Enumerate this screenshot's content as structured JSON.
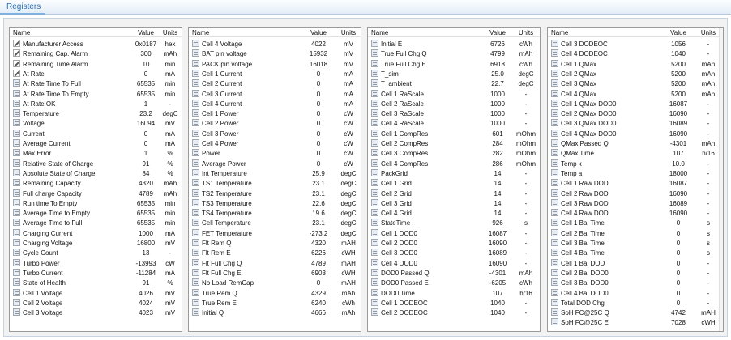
{
  "window": {
    "title": "Registers"
  },
  "columns": {
    "name": "Name",
    "value": "Value",
    "units": "Units"
  },
  "panels": [
    {
      "rows": [
        {
          "name": "Manufacturer Access",
          "value": "0x0187",
          "units": "hex",
          "icon": "edit-icon"
        },
        {
          "name": "Remaining Cap. Alarm",
          "value": "300",
          "units": "mAh",
          "icon": "edit-icon"
        },
        {
          "name": "Remaining Time Alarm",
          "value": "10",
          "units": "min",
          "icon": "edit-icon"
        },
        {
          "name": "At Rate",
          "value": "0",
          "units": "mA",
          "icon": "edit-icon"
        },
        {
          "name": "At Rate Time To Full",
          "value": "65535",
          "units": "min",
          "icon": "readonly-icon"
        },
        {
          "name": "At Rate Time To Empty",
          "value": "65535",
          "units": "min",
          "icon": "readonly-icon"
        },
        {
          "name": "At Rate OK",
          "value": "1",
          "units": "-",
          "icon": "readonly-icon"
        },
        {
          "name": "Temperature",
          "value": "23.2",
          "units": "degC",
          "icon": "readonly-icon"
        },
        {
          "name": "Voltage",
          "value": "16094",
          "units": "mV",
          "icon": "readonly-icon"
        },
        {
          "name": "Current",
          "value": "0",
          "units": "mA",
          "icon": "readonly-icon"
        },
        {
          "name": "Average Current",
          "value": "0",
          "units": "mA",
          "icon": "readonly-icon"
        },
        {
          "name": "Max Error",
          "value": "1",
          "units": "%",
          "icon": "readonly-icon"
        },
        {
          "name": "Relative State of Charge",
          "value": "91",
          "units": "%",
          "icon": "readonly-icon"
        },
        {
          "name": "Absolute State of Charge",
          "value": "84",
          "units": "%",
          "icon": "readonly-icon"
        },
        {
          "name": "Remaining Capacity",
          "value": "4320",
          "units": "mAh",
          "icon": "readonly-icon"
        },
        {
          "name": "Full charge Capacity",
          "value": "4789",
          "units": "mAh",
          "icon": "readonly-icon"
        },
        {
          "name": "Run time To Empty",
          "value": "65535",
          "units": "min",
          "icon": "readonly-icon"
        },
        {
          "name": "Average Time to Empty",
          "value": "65535",
          "units": "min",
          "icon": "readonly-icon"
        },
        {
          "name": "Average Time to Full",
          "value": "65535",
          "units": "min",
          "icon": "readonly-icon"
        },
        {
          "name": "Charging Current",
          "value": "1000",
          "units": "mA",
          "icon": "readonly-icon"
        },
        {
          "name": "Charging Voltage",
          "value": "16800",
          "units": "mV",
          "icon": "readonly-icon"
        },
        {
          "name": "Cycle Count",
          "value": "13",
          "units": "-",
          "icon": "readonly-icon"
        },
        {
          "name": "Turbo Power",
          "value": "-13993",
          "units": "cW",
          "icon": "readonly-icon"
        },
        {
          "name": "Turbo Current",
          "value": "-11284",
          "units": "mA",
          "icon": "readonly-icon"
        },
        {
          "name": "State of Health",
          "value": "91",
          "units": "%",
          "icon": "readonly-icon"
        },
        {
          "name": "Cell 1 Voltage",
          "value": "4026",
          "units": "mV",
          "icon": "readonly-icon"
        },
        {
          "name": "Cell 2 Voltage",
          "value": "4024",
          "units": "mV",
          "icon": "readonly-icon"
        },
        {
          "name": "Cell 3 Voltage",
          "value": "4023",
          "units": "mV",
          "icon": "readonly-icon"
        }
      ]
    },
    {
      "rows": [
        {
          "name": "Cell 4 Voltage",
          "value": "4022",
          "units": "mV",
          "icon": "readonly-icon"
        },
        {
          "name": "BAT pin voltage",
          "value": "15932",
          "units": "mV",
          "icon": "readonly-icon"
        },
        {
          "name": "PACK pin voltage",
          "value": "16018",
          "units": "mV",
          "icon": "readonly-icon"
        },
        {
          "name": "Cell 1 Current",
          "value": "0",
          "units": "mA",
          "icon": "readonly-icon"
        },
        {
          "name": "Cell 2 Current",
          "value": "0",
          "units": "mA",
          "icon": "readonly-icon"
        },
        {
          "name": "Cell 3 Current",
          "value": "0",
          "units": "mA",
          "icon": "readonly-icon"
        },
        {
          "name": "Cell 4 Current",
          "value": "0",
          "units": "mA",
          "icon": "readonly-icon"
        },
        {
          "name": "Cell 1 Power",
          "value": "0",
          "units": "cW",
          "icon": "readonly-icon"
        },
        {
          "name": "Cell 2 Power",
          "value": "0",
          "units": "cW",
          "icon": "readonly-icon"
        },
        {
          "name": "Cell 3 Power",
          "value": "0",
          "units": "cW",
          "icon": "readonly-icon"
        },
        {
          "name": "Cell 4 Power",
          "value": "0",
          "units": "cW",
          "icon": "readonly-icon"
        },
        {
          "name": "Power",
          "value": "0",
          "units": "cW",
          "icon": "readonly-icon"
        },
        {
          "name": "Average Power",
          "value": "0",
          "units": "cW",
          "icon": "readonly-icon"
        },
        {
          "name": "Int Temperature",
          "value": "25.9",
          "units": "degC",
          "icon": "readonly-icon"
        },
        {
          "name": "TS1 Temperature",
          "value": "23.1",
          "units": "degC",
          "icon": "readonly-icon"
        },
        {
          "name": "TS2 Temperature",
          "value": "23.1",
          "units": "degC",
          "icon": "readonly-icon"
        },
        {
          "name": "TS3 Temperature",
          "value": "22.6",
          "units": "degC",
          "icon": "readonly-icon"
        },
        {
          "name": "TS4 Temperature",
          "value": "19.6",
          "units": "degC",
          "icon": "readonly-icon"
        },
        {
          "name": "Cell Temperature",
          "value": "23.1",
          "units": "degC",
          "icon": "readonly-icon"
        },
        {
          "name": "FET Temperature",
          "value": "-273.2",
          "units": "degC",
          "icon": "readonly-icon"
        },
        {
          "name": "Flt Rem Q",
          "value": "4320",
          "units": "mAH",
          "icon": "readonly-icon"
        },
        {
          "name": "Flt Rem E",
          "value": "6226",
          "units": "cWH",
          "icon": "readonly-icon"
        },
        {
          "name": "Flt Full Chg Q",
          "value": "4789",
          "units": "mAH",
          "icon": "readonly-icon"
        },
        {
          "name": "Flt Full Chg E",
          "value": "6903",
          "units": "cWH",
          "icon": "readonly-icon"
        },
        {
          "name": "No Load RemCap",
          "value": "0",
          "units": "mAH",
          "icon": "readonly-icon"
        },
        {
          "name": "True Rem Q",
          "value": "4329",
          "units": "mAh",
          "icon": "readonly-icon"
        },
        {
          "name": "True Rem E",
          "value": "6240",
          "units": "cWh",
          "icon": "readonly-icon"
        },
        {
          "name": "Initial Q",
          "value": "4666",
          "units": "mAh",
          "icon": "readonly-icon"
        }
      ]
    },
    {
      "rows": [
        {
          "name": "Initial E",
          "value": "6726",
          "units": "cWh",
          "icon": "readonly-icon"
        },
        {
          "name": "True Full Chg Q",
          "value": "4799",
          "units": "mAh",
          "icon": "readonly-icon"
        },
        {
          "name": "True Full Chg E",
          "value": "6918",
          "units": "cWh",
          "icon": "readonly-icon"
        },
        {
          "name": "T_sim",
          "value": "25.0",
          "units": "degC",
          "icon": "readonly-icon"
        },
        {
          "name": "T_ambient",
          "value": "22.7",
          "units": "degC",
          "icon": "readonly-icon"
        },
        {
          "name": "Cell 1 RaScale",
          "value": "1000",
          "units": "-",
          "icon": "readonly-icon"
        },
        {
          "name": "Cell 2 RaScale",
          "value": "1000",
          "units": "-",
          "icon": "readonly-icon"
        },
        {
          "name": "Cell 3 RaScale",
          "value": "1000",
          "units": "-",
          "icon": "readonly-icon"
        },
        {
          "name": "Cell 4 RaScale",
          "value": "1000",
          "units": "-",
          "icon": "readonly-icon"
        },
        {
          "name": "Cell 1 CompRes",
          "value": "601",
          "units": "mOhm",
          "icon": "readonly-icon"
        },
        {
          "name": "Cell 2 CompRes",
          "value": "284",
          "units": "mOhm",
          "icon": "readonly-icon"
        },
        {
          "name": "Cell 3 CompRes",
          "value": "282",
          "units": "mOhm",
          "icon": "readonly-icon"
        },
        {
          "name": "Cell 4 CompRes",
          "value": "286",
          "units": "mOhm",
          "icon": "readonly-icon"
        },
        {
          "name": "PackGrid",
          "value": "14",
          "units": "-",
          "icon": "readonly-icon"
        },
        {
          "name": "Cell 1 Grid",
          "value": "14",
          "units": "-",
          "icon": "readonly-icon"
        },
        {
          "name": "Cell 2 Grid",
          "value": "14",
          "units": "-",
          "icon": "readonly-icon"
        },
        {
          "name": "Cell 3 Grid",
          "value": "14",
          "units": "-",
          "icon": "readonly-icon"
        },
        {
          "name": "Cell 4 Grid",
          "value": "14",
          "units": "-",
          "icon": "readonly-icon"
        },
        {
          "name": "StateTime",
          "value": "926",
          "units": "s",
          "icon": "readonly-icon"
        },
        {
          "name": "Cell 1 DOD0",
          "value": "16087",
          "units": "-",
          "icon": "readonly-icon"
        },
        {
          "name": "Cell 2 DOD0",
          "value": "16090",
          "units": "-",
          "icon": "readonly-icon"
        },
        {
          "name": "Cell 3 DOD0",
          "value": "16089",
          "units": "-",
          "icon": "readonly-icon"
        },
        {
          "name": "Cell 4 DOD0",
          "value": "16090",
          "units": "-",
          "icon": "readonly-icon"
        },
        {
          "name": "DOD0 Passed Q",
          "value": "-4301",
          "units": "mAh",
          "icon": "readonly-icon"
        },
        {
          "name": "DOD0 Passed E",
          "value": "-6205",
          "units": "cWh",
          "icon": "readonly-icon"
        },
        {
          "name": "DOD0 Time",
          "value": "107",
          "units": "h/16",
          "icon": "readonly-icon"
        },
        {
          "name": "Cell 1 DODEOC",
          "value": "1040",
          "units": "-",
          "icon": "readonly-icon"
        },
        {
          "name": "Cell 2 DODEOC",
          "value": "1040",
          "units": "-",
          "icon": "readonly-icon"
        }
      ]
    },
    {
      "rows": [
        {
          "name": "Cell 3 DODEOC",
          "value": "1056",
          "units": "-",
          "icon": "readonly-icon"
        },
        {
          "name": "Cell 4 DODEOC",
          "value": "1040",
          "units": "-",
          "icon": "readonly-icon"
        },
        {
          "name": "Cell 1 QMax",
          "value": "5200",
          "units": "mAh",
          "icon": "readonly-icon"
        },
        {
          "name": "Cell 2 QMax",
          "value": "5200",
          "units": "mAh",
          "icon": "readonly-icon"
        },
        {
          "name": "Cell 3 QMax",
          "value": "5200",
          "units": "mAh",
          "icon": "readonly-icon"
        },
        {
          "name": "Cell 4 QMax",
          "value": "5200",
          "units": "mAh",
          "icon": "readonly-icon"
        },
        {
          "name": "Cell 1 QMax DOD0",
          "value": "16087",
          "units": "-",
          "icon": "readonly-icon"
        },
        {
          "name": "Cell 2 QMax DOD0",
          "value": "16090",
          "units": "-",
          "icon": "readonly-icon"
        },
        {
          "name": "Cell 3 QMax DOD0",
          "value": "16089",
          "units": "-",
          "icon": "readonly-icon"
        },
        {
          "name": "Cell 4 QMax DOD0",
          "value": "16090",
          "units": "-",
          "icon": "readonly-icon"
        },
        {
          "name": "QMax Passed Q",
          "value": "-4301",
          "units": "mAh",
          "icon": "readonly-icon"
        },
        {
          "name": "QMax Time",
          "value": "107",
          "units": "h/16",
          "icon": "readonly-icon"
        },
        {
          "name": "Temp k",
          "value": "10.0",
          "units": "-",
          "icon": "readonly-icon"
        },
        {
          "name": "Temp a",
          "value": "18000",
          "units": "-",
          "icon": "readonly-icon"
        },
        {
          "name": "Cell 1 Raw DOD",
          "value": "16087",
          "units": "-",
          "icon": "readonly-icon"
        },
        {
          "name": "Cell 2 Raw DOD",
          "value": "16090",
          "units": "-",
          "icon": "readonly-icon"
        },
        {
          "name": "Cell 3 Raw DOD",
          "value": "16089",
          "units": "-",
          "icon": "readonly-icon"
        },
        {
          "name": "Cell 4 Raw DOD",
          "value": "16090",
          "units": "-",
          "icon": "readonly-icon"
        },
        {
          "name": "Cell 1 Bal Time",
          "value": "0",
          "units": "s",
          "icon": "readonly-icon"
        },
        {
          "name": "Cell 2 Bal Time",
          "value": "0",
          "units": "s",
          "icon": "readonly-icon"
        },
        {
          "name": "Cell 3 Bal Time",
          "value": "0",
          "units": "s",
          "icon": "readonly-icon"
        },
        {
          "name": "Cell 4 Bal Time",
          "value": "0",
          "units": "s",
          "icon": "readonly-icon"
        },
        {
          "name": "Cell 1 Bal DOD",
          "value": "0",
          "units": "-",
          "icon": "readonly-icon"
        },
        {
          "name": "Cell 2 Bal DOD0",
          "value": "0",
          "units": "-",
          "icon": "readonly-icon"
        },
        {
          "name": "Cell 3 Bal DOD0",
          "value": "0",
          "units": "-",
          "icon": "readonly-icon"
        },
        {
          "name": "Cell 4 Bal DOD0",
          "value": "0",
          "units": "-",
          "icon": "readonly-icon"
        },
        {
          "name": "Total DOD Chg",
          "value": "0",
          "units": "-",
          "icon": "readonly-icon"
        },
        {
          "name": "SoH FC@25C Q",
          "value": "4742",
          "units": "mAH",
          "icon": "readonly-icon"
        },
        {
          "name": "SoH FC@25C E",
          "value": "7028",
          "units": "cWH",
          "icon": "readonly-icon"
        }
      ]
    }
  ]
}
